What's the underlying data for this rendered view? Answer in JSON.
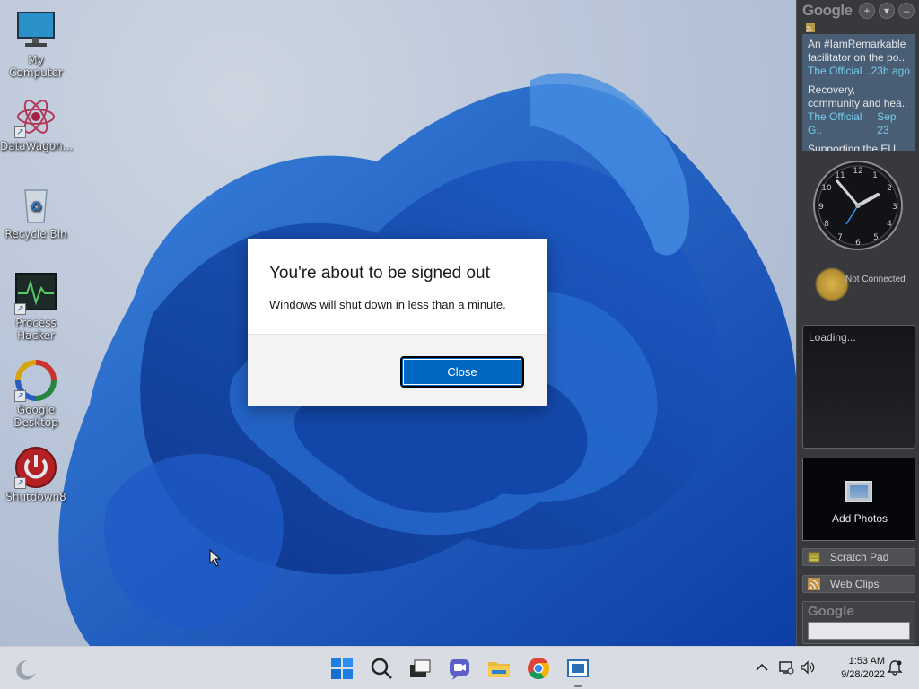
{
  "desktop": {
    "icons": [
      {
        "label": "My Computer"
      },
      {
        "label": "DataWagon..."
      },
      {
        "label": "Recycle Bin"
      },
      {
        "label": "Process Hacker"
      },
      {
        "label": "Google Desktop"
      },
      {
        "label": "Shutdown8"
      }
    ]
  },
  "dialog": {
    "title": "You're about to be signed out",
    "message": "Windows will shut down in less than a minute.",
    "close_label": "Close"
  },
  "sidebar": {
    "logo": "Google",
    "news": [
      {
        "text": "An #IamRemarkable facilitator on the po..",
        "source": "The Official ..",
        "time": "23h ago"
      },
      {
        "text": "Recovery, community and hea..",
        "source": "The Official G..",
        "time": "Sep 23"
      },
      {
        "text": "Supporting the EU and securing the dig..",
        "source": "",
        "time": ""
      }
    ],
    "weather_status": "Not Connected",
    "loading_text": "Loading...",
    "photos_label": "Add Photos",
    "scratch_pad_label": "Scratch Pad",
    "web_clips_label": "Web Clips",
    "search_logo": "Google"
  },
  "taskbar": {
    "time": "1:53 AM",
    "date": "9/28/2022",
    "icons": [
      "start-icon",
      "search-icon",
      "task-view-icon",
      "chat-icon",
      "file-explorer-icon",
      "chrome-icon",
      "app-icon"
    ]
  },
  "colors": {
    "accent": "#0067c0",
    "news_bg": "#4e6478",
    "news_meta": "#7ee0ff"
  }
}
